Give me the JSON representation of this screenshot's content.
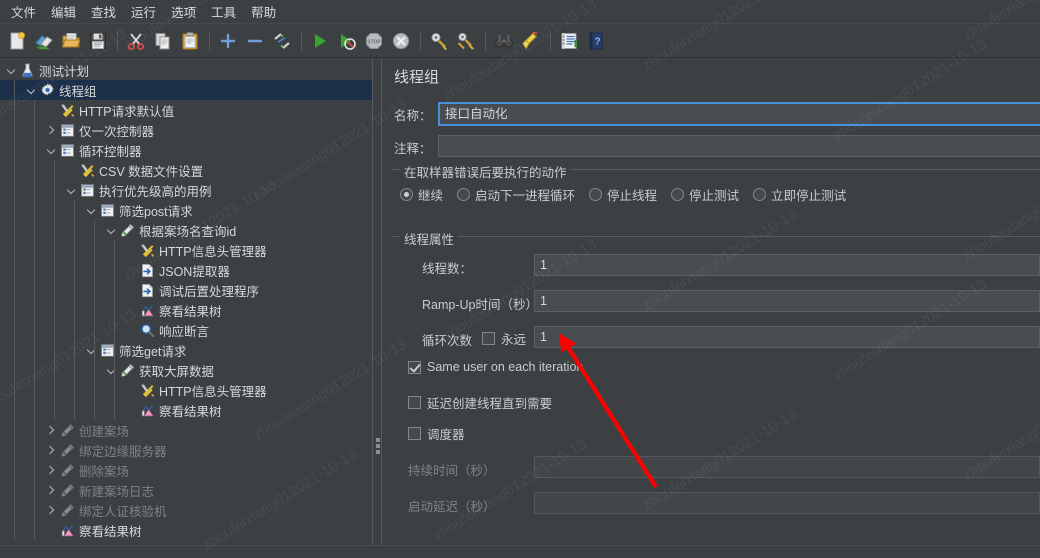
{
  "window": {
    "title": "线程组",
    "watermark_text": "zhoufeixiang012021-10-13",
    "accent_color": "#4a90d9",
    "selection_color": "#1c3049",
    "background_color": "#3c4043",
    "annotation_color": "#ff0000"
  },
  "menubar": {
    "items": [
      {
        "label": "文件"
      },
      {
        "label": "编辑"
      },
      {
        "label": "查找"
      },
      {
        "label": "运行"
      },
      {
        "label": "选项"
      },
      {
        "label": "工具"
      },
      {
        "label": "帮助"
      }
    ]
  },
  "toolbar": {
    "items": [
      {
        "icon": "new-document-icon",
        "label": "新建"
      },
      {
        "icon": "templates-icon",
        "label": "模板"
      },
      {
        "icon": "open-folder-icon",
        "label": "打开"
      },
      {
        "icon": "save-icon",
        "label": "保存"
      },
      {
        "icon": "separator",
        "label": ""
      },
      {
        "icon": "cut-scissors-icon",
        "label": "剪切"
      },
      {
        "icon": "copy-icon",
        "label": "复制"
      },
      {
        "icon": "paste-clipboard-icon",
        "label": "粘贴"
      },
      {
        "icon": "separator",
        "label": ""
      },
      {
        "icon": "expand-plus-icon",
        "label": "展开全部"
      },
      {
        "icon": "collapse-minus-icon",
        "label": "收起全部"
      },
      {
        "icon": "toggle-enable-icon",
        "label": "启用/禁用"
      },
      {
        "icon": "separator",
        "label": ""
      },
      {
        "icon": "run-play-icon",
        "label": "启动"
      },
      {
        "icon": "run-no-timers-icon",
        "label": "无间隔启动"
      },
      {
        "icon": "stop-icon",
        "label": "停止"
      },
      {
        "icon": "shutdown-icon",
        "label": "关闭"
      },
      {
        "icon": "separator",
        "label": ""
      },
      {
        "icon": "clear-icon",
        "label": "清除"
      },
      {
        "icon": "clear-all-icon",
        "label": "清除全部"
      },
      {
        "icon": "separator",
        "label": ""
      },
      {
        "icon": "search-binoculars-icon",
        "label": "查找"
      },
      {
        "icon": "reset-search-icon",
        "label": "重置查找"
      },
      {
        "icon": "separator",
        "label": ""
      },
      {
        "icon": "function-helper-icon",
        "label": "函数助手对话框"
      },
      {
        "icon": "help-book-icon",
        "label": "帮助"
      }
    ]
  },
  "tree": {
    "nodes": [
      {
        "label": "测试计划",
        "depth": 0,
        "icon": "test-plan-flask-icon",
        "toggle": "down",
        "selected": false,
        "disabled": false
      },
      {
        "label": "线程组",
        "depth": 1,
        "icon": "thread-group-gear-icon",
        "toggle": "down",
        "selected": true,
        "disabled": false
      },
      {
        "label": "HTTP请求默认值",
        "depth": 2,
        "icon": "config-wrench-icon",
        "toggle": "none",
        "selected": false,
        "disabled": false
      },
      {
        "label": "仅一次控制器",
        "depth": 2,
        "icon": "controller-icon",
        "toggle": "right",
        "selected": false,
        "disabled": false
      },
      {
        "label": "循环控制器",
        "depth": 2,
        "icon": "controller-icon",
        "toggle": "down",
        "selected": false,
        "disabled": false
      },
      {
        "label": "CSV 数据文件设置",
        "depth": 3,
        "icon": "config-wrench-icon",
        "toggle": "none",
        "selected": false,
        "disabled": false
      },
      {
        "label": "执行优先级高的用例",
        "depth": 3,
        "icon": "controller-icon",
        "toggle": "down",
        "selected": false,
        "disabled": false
      },
      {
        "label": "筛选post请求",
        "depth": 4,
        "icon": "controller-icon",
        "toggle": "down",
        "selected": false,
        "disabled": false
      },
      {
        "label": "根据案场名查询id",
        "depth": 5,
        "icon": "http-sampler-icon",
        "toggle": "down",
        "selected": false,
        "disabled": false
      },
      {
        "label": "HTTP信息头管理器",
        "depth": 6,
        "icon": "config-wrench-icon",
        "toggle": "none",
        "selected": false,
        "disabled": false
      },
      {
        "label": "JSON提取器",
        "depth": 6,
        "icon": "post-processor-icon",
        "toggle": "none",
        "selected": false,
        "disabled": false
      },
      {
        "label": "调试后置处理程序",
        "depth": 6,
        "icon": "post-processor-icon",
        "toggle": "none",
        "selected": false,
        "disabled": false
      },
      {
        "label": "察看结果树",
        "depth": 6,
        "icon": "view-results-tree-icon",
        "toggle": "none",
        "selected": false,
        "disabled": false
      },
      {
        "label": "响应断言",
        "depth": 6,
        "icon": "assertion-magnifier-icon",
        "toggle": "none",
        "selected": false,
        "disabled": false
      },
      {
        "label": "筛选get请求",
        "depth": 4,
        "icon": "controller-icon",
        "toggle": "down",
        "selected": false,
        "disabled": false
      },
      {
        "label": "获取大屏数据",
        "depth": 5,
        "icon": "http-sampler-icon",
        "toggle": "down",
        "selected": false,
        "disabled": false
      },
      {
        "label": "HTTP信息头管理器",
        "depth": 6,
        "icon": "config-wrench-icon",
        "toggle": "none",
        "selected": false,
        "disabled": false
      },
      {
        "label": "察看结果树",
        "depth": 6,
        "icon": "view-results-tree-icon",
        "toggle": "none",
        "selected": false,
        "disabled": false
      },
      {
        "label": "创建案场",
        "depth": 2,
        "icon": "http-sampler-icon",
        "toggle": "right",
        "selected": false,
        "disabled": true
      },
      {
        "label": "绑定边缘服务器",
        "depth": 2,
        "icon": "http-sampler-icon",
        "toggle": "right",
        "selected": false,
        "disabled": true
      },
      {
        "label": "删除案场",
        "depth": 2,
        "icon": "http-sampler-icon",
        "toggle": "right",
        "selected": false,
        "disabled": true
      },
      {
        "label": "新建案场日志",
        "depth": 2,
        "icon": "http-sampler-icon",
        "toggle": "right",
        "selected": false,
        "disabled": true
      },
      {
        "label": "绑定人证核验机",
        "depth": 2,
        "icon": "http-sampler-icon",
        "toggle": "right",
        "selected": false,
        "disabled": true
      },
      {
        "label": "察看结果树",
        "depth": 2,
        "icon": "view-results-tree-icon",
        "toggle": "none",
        "selected": false,
        "disabled": false
      }
    ]
  },
  "detail": {
    "title": "线程组",
    "name_label": "名称：",
    "name_value": "接口自动化",
    "comment_label": "注释：",
    "comment_value": "",
    "error_action": {
      "group_label": "在取样器错误后要执行的动作",
      "options": [
        {
          "label": "继续",
          "selected": true
        },
        {
          "label": "启动下一进程循环",
          "selected": false
        },
        {
          "label": "停止线程",
          "selected": false
        },
        {
          "label": "停止测试",
          "selected": false
        },
        {
          "label": "立即停止测试",
          "selected": false
        }
      ]
    },
    "thread_properties": {
      "group_label": "线程属性",
      "num_threads_label": "线程数：",
      "num_threads_value": "1",
      "ramp_up_label": "Ramp-Up时间（秒）：",
      "ramp_up_value": "1",
      "loop_count_label": "循环次数",
      "forever_label": "永远",
      "forever_checked": false,
      "loop_count_value": "1",
      "checkboxes": [
        {
          "label": "Same user on each iteration",
          "checked": true
        },
        {
          "label": "延迟创建线程直到需要",
          "checked": false
        },
        {
          "label": "调度器",
          "checked": false
        }
      ],
      "duration_label": "持续时间（秒）",
      "duration_value": "",
      "duration_disabled": true,
      "startup_delay_label": "启动延迟（秒）",
      "startup_delay_value": "",
      "startup_delay_disabled": true
    }
  }
}
